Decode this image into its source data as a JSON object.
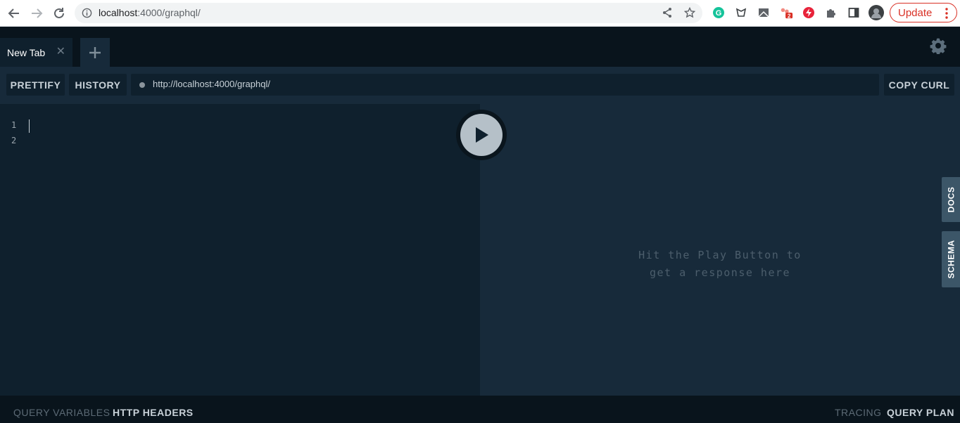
{
  "browser": {
    "url_host": "localhost",
    "url_rest": ":4000/graphql/",
    "update_label": "Update",
    "ext_badge": "2"
  },
  "tabs": [
    {
      "label": "New Tab",
      "close": "✕"
    }
  ],
  "toolbar": {
    "prettify_label": "PRETTIFY",
    "history_label": "HISTORY",
    "endpoint": "http://localhost:4000/graphql/",
    "copy_curl_label": "COPY CURL"
  },
  "editor": {
    "line_numbers": [
      "1",
      "2"
    ]
  },
  "result": {
    "hint": "Hit the Play Button to\nget a response here"
  },
  "side_tabs": {
    "docs_label": "DOCS",
    "schema_label": "SCHEMA"
  },
  "footer": {
    "query_variables_label": "QUERY VARIABLES",
    "http_headers_label": "HTTP HEADERS",
    "tracing_label": "TRACING",
    "query_plan_label": "QUERY PLAN"
  },
  "colors": {
    "editor_bg": "#0f202d",
    "result_bg": "#172a3a",
    "bar_bg": "#09141c",
    "update_red": "#d93025"
  },
  "icons": [
    "back-arrow-icon",
    "forward-arrow-icon",
    "reload-icon",
    "info-icon",
    "share-icon",
    "star-icon",
    "grammarly-icon",
    "extension-icon",
    "puzzle-icon",
    "sidebar-icon",
    "profile-avatar",
    "more-vert-icon",
    "plus-icon",
    "gear-icon",
    "play-icon"
  ]
}
